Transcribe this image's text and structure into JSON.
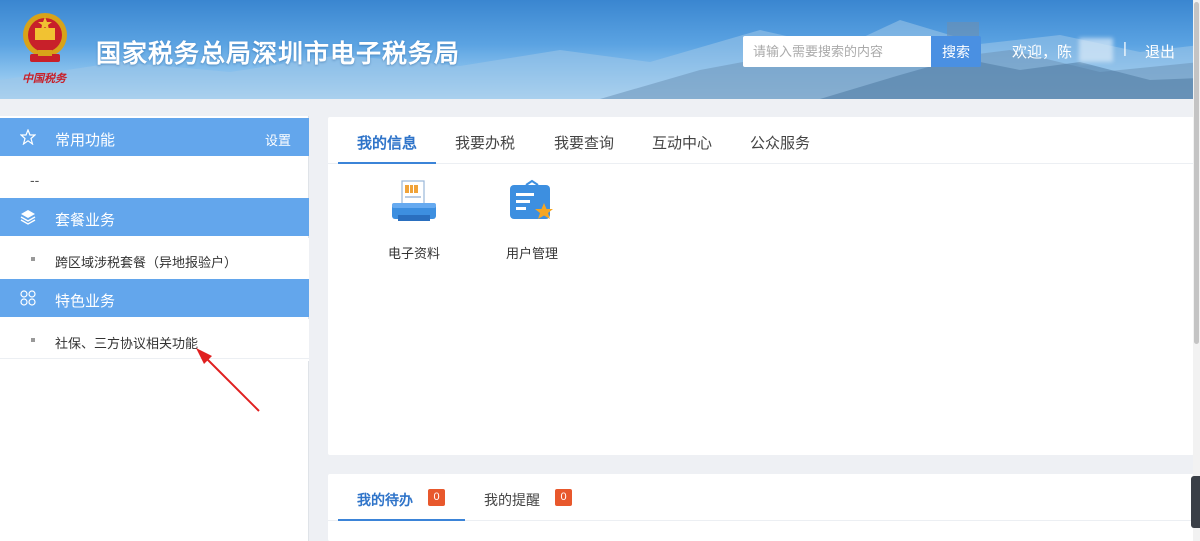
{
  "header": {
    "emblem_caption": "中国税务",
    "title": "国家税务总局深圳市电子税务局",
    "search_placeholder": "请输入需要搜索的内容",
    "search_button": "搜索",
    "welcome": "欢迎，陈",
    "divider": "|",
    "logout": "退出"
  },
  "sidebar": {
    "section_common": {
      "label": "常用功能",
      "setting": "设置",
      "icon": "star-icon"
    },
    "common_placeholder": "--",
    "section_package": {
      "label": "套餐业务",
      "icon": "layers-icon"
    },
    "package_items": [
      "跨区域涉税套餐（异地报验户）"
    ],
    "section_special": {
      "label": "特色业务",
      "icon": "grid-icon"
    },
    "special_items": [
      "社保、三方协议相关功能"
    ]
  },
  "main": {
    "tabs": [
      {
        "label": "我的信息",
        "active": true
      },
      {
        "label": "我要办税",
        "active": false
      },
      {
        "label": "我要查询",
        "active": false
      },
      {
        "label": "互动中心",
        "active": false
      },
      {
        "label": "公众服务",
        "active": false
      }
    ],
    "tiles": [
      {
        "label": "电子资料",
        "icon": "printer-document-icon"
      },
      {
        "label": "用户管理",
        "icon": "user-card-star-icon"
      }
    ]
  },
  "todo": {
    "tabs": [
      {
        "label": "我的待办",
        "count": "0",
        "active": true
      },
      {
        "label": "我的提醒",
        "count": "0",
        "active": false
      }
    ]
  },
  "colors": {
    "header_top": "#3a86d0",
    "sidebar_head": "#63a6ec",
    "accent": "#2f74c9",
    "badge": "#e8582c",
    "annotation_arrow": "#e02020"
  }
}
